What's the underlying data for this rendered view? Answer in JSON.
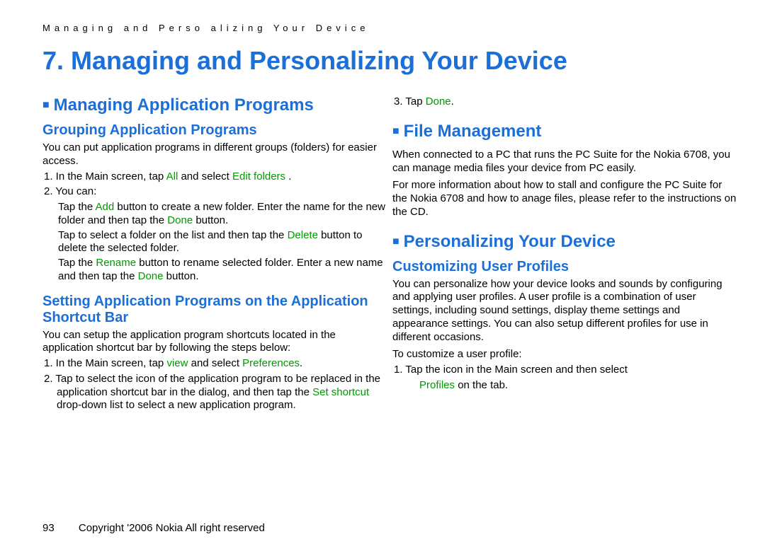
{
  "header": {
    "runner": "Managing and Perso alizing Your Device"
  },
  "chapter": {
    "title": "7.  Managing and Personalizing Your Device"
  },
  "left": {
    "section1": {
      "title": "Managing Application Programs"
    },
    "sub1": {
      "title": "Grouping Application Programs",
      "intro": "You can put application programs in different groups (folders) for easier access.",
      "step1_a": "1.   In the Main screen, tap",
      "step1_b": "All",
      "step1_c": " and select",
      "step1_d": "Edit folders",
      "step1_e": ".",
      "step2": "2.   You can:",
      "bullet1_a": "Tap the ",
      "bullet1_b": "Add",
      "bullet1_c": " button to create a new folder. Enter the name for the new folder and then tap the ",
      "bullet1_d": "Done",
      "bullet1_e": " button.",
      "bullet2_a": "Tap to select a folder on the list and then tap the ",
      "bullet2_b": "Delete",
      "bullet2_c": " button to delete the selected folder.",
      "bullet3_a": "Tap the ",
      "bullet3_b": "Rename",
      "bullet3_c": " button to rename selected folder. Enter a new name and then tap the ",
      "bullet3_d": "Done",
      "bullet3_e": " button."
    },
    "sub2": {
      "title": "Setting Application Programs on the Application Shortcut Bar",
      "intro": "You can setup the application program shortcuts located in the application shortcut bar by following the steps below:",
      "step1_a": "1.   In the Main screen, tap ",
      "step1_b": "view",
      "step1_c": " and select ",
      "step1_d": "Preferences",
      "step1_e": ".",
      "step2_a": "2.   Tap to select the icon of the application program to be replaced in the application shortcut bar in the dialog, and then tap the ",
      "step2_b": "Set shortcut",
      "step2_c": " drop-down list to select a new application program."
    }
  },
  "right": {
    "step3_a": "3.   Tap",
    "step3_b": "Done",
    "step3_c": ".",
    "section2": {
      "title": "File Management",
      "p1": "When connected to a PC that runs the PC Suite for the Nokia 6708, you can manage media files your device from PC easily.",
      "p2": "For more information about how to stall and configure the PC Suite for the Nokia 6708 and how to anage files, please refer to the instructions on the CD."
    },
    "section3": {
      "title": "Personalizing Your Device"
    },
    "sub3": {
      "title": "Customizing User Profiles",
      "p1": "You can personalize how your device looks and sounds by configuring and applying user profiles. A user profile is a combination of user settings, including sound settings, display theme settings and appearance settings. You can also setup different profiles for use in different occasions.",
      "p2": "To customize a user profile:",
      "step1_a": "1.   Tap the         icon in the Main screen and then select",
      "step1_b": "Profiles",
      "step1_c": " on the           tab."
    }
  },
  "footer": {
    "page": "93",
    "copyright": "Copyright '2006 Nokia All right reserved"
  }
}
